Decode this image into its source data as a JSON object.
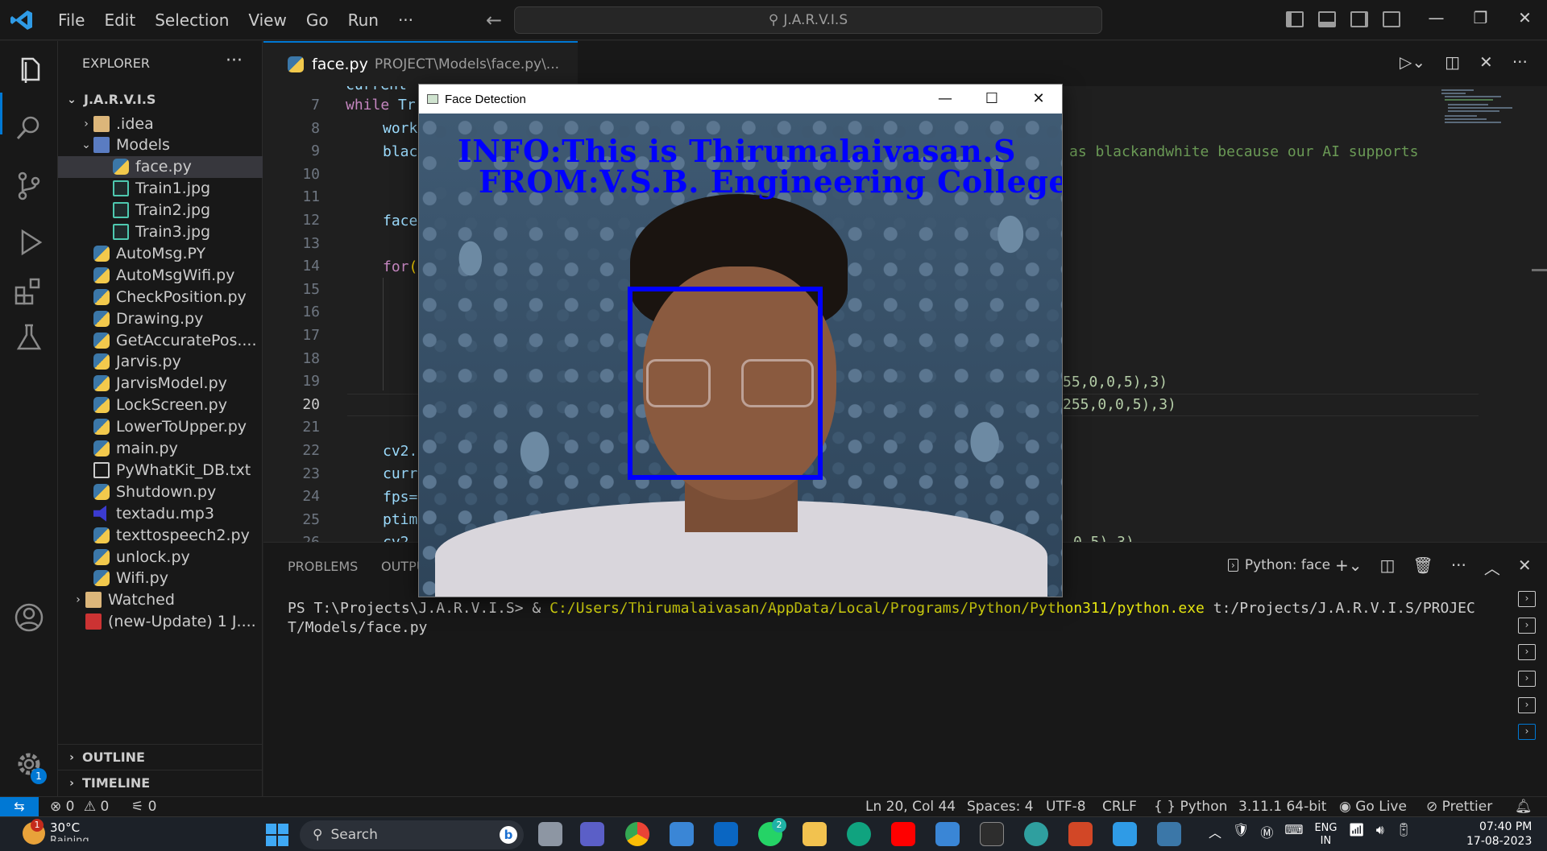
{
  "titlebar": {
    "menus": [
      "File",
      "Edit",
      "Selection",
      "View",
      "Go",
      "Run",
      "···"
    ],
    "command_center": "J.A.R.V.I.S"
  },
  "sidebar": {
    "header": "EXPLORER",
    "root": "J.A.R.V.I.S",
    "items": [
      {
        "label": ".idea",
        "depth": 1,
        "kind": "folder",
        "twisty": "›"
      },
      {
        "label": "Models",
        "depth": 1,
        "kind": "folderblue",
        "twisty": "⌄"
      },
      {
        "label": "face.py",
        "depth": 2,
        "kind": "py",
        "selected": true
      },
      {
        "label": "Train1.jpg",
        "depth": 2,
        "kind": "img"
      },
      {
        "label": "Train2.jpg",
        "depth": 2,
        "kind": "img"
      },
      {
        "label": "Train3.jpg",
        "depth": 2,
        "kind": "img"
      },
      {
        "label": "AutoMsg.PY",
        "depth": 1,
        "kind": "py"
      },
      {
        "label": "AutoMsgWifi.py",
        "depth": 1,
        "kind": "py"
      },
      {
        "label": "CheckPosition.py",
        "depth": 1,
        "kind": "py"
      },
      {
        "label": "Drawing.py",
        "depth": 1,
        "kind": "py"
      },
      {
        "label": "GetAccuratePos....",
        "depth": 1,
        "kind": "py"
      },
      {
        "label": "Jarvis.py",
        "depth": 1,
        "kind": "py"
      },
      {
        "label": "JarvisModel.py",
        "depth": 1,
        "kind": "py"
      },
      {
        "label": "LockScreen.py",
        "depth": 1,
        "kind": "py"
      },
      {
        "label": "LowerToUpper.py",
        "depth": 1,
        "kind": "py"
      },
      {
        "label": "main.py",
        "depth": 1,
        "kind": "py"
      },
      {
        "label": "PyWhatKit_DB.txt",
        "depth": 1,
        "kind": "txt"
      },
      {
        "label": "Shutdown.py",
        "depth": 1,
        "kind": "py"
      },
      {
        "label": "textadu.mp3",
        "depth": 1,
        "kind": "mp3"
      },
      {
        "label": "texttospeech2.py",
        "depth": 1,
        "kind": "py"
      },
      {
        "label": "unlock.py",
        "depth": 1,
        "kind": "py"
      },
      {
        "label": "Wifi.py",
        "depth": 1,
        "kind": "py"
      },
      {
        "label": "Watched",
        "depth": 0,
        "kind": "folder",
        "twisty": "›"
      },
      {
        "label": "(new-Update) 1 J....",
        "depth": 0,
        "kind": "vid"
      }
    ],
    "outline": "OUTLINE",
    "timeline": "TIMELINE"
  },
  "editor": {
    "tab_name": "face.py",
    "tab_path": "PROJECT\\Models\\face.py\\...",
    "line_numbers": [
      "7",
      "8",
      "9",
      "10",
      "11",
      "12",
      "13",
      "14",
      "15",
      "16",
      "17",
      "18",
      "19",
      "20",
      "21",
      "22",
      "23",
      "24",
      "25",
      "26"
    ],
    "current_line": "20",
    "code_fragments": {
      "l6": "current",
      "l7_kw": "while",
      "l7_rest": " Tr",
      "l8": "work",
      "l9": "blac",
      "l9_comment": "as blackandwhite because our AI supports",
      "l12": "face",
      "l14_kw": "for",
      "l14_br": "(",
      "l19_tail": "55,0,0,5),3)",
      "l20_tail": "255,0,0,5),3)",
      "l22": "cv2.",
      "l23": "curr",
      "l24": "fps=",
      "l25": "ptim",
      "l26": "cv2.",
      "l26_tail": "0,5),3)"
    }
  },
  "face_window": {
    "title": "Face Detection",
    "overlay_line1": "INFO:This is Thirumalaivasan.S",
    "overlay_line2": "FROM:V.S.B. Engineering College",
    "box_color": "#0000ff"
  },
  "panel": {
    "tabs": [
      "PROBLEMS",
      "OUTPU"
    ],
    "terminal_name": "Python: face",
    "prompt": "PS T:\\Projects\\J.A.R.V.I.S> & ",
    "exe": "C:/Users/Thirumalaivasan/AppData/Local/Programs/Python/Python311/python.exe",
    "args": " t:/Projects/J.A.R.V.I.S/PROJECT/Models/face.py"
  },
  "statusbar": {
    "errors": "0",
    "warnings": "0",
    "ports": "0",
    "position": "Ln 20, Col 44",
    "spaces": "Spaces: 4",
    "encoding": "UTF-8",
    "eol": "CRLF",
    "language": "Python",
    "interpreter": "3.11.1 64-bit",
    "golive": "Go Live",
    "prettier": "Prettier"
  },
  "taskbar": {
    "weather_temp": "30°C",
    "weather_badge": "1",
    "weather_desc": "Raining",
    "search": "Search",
    "whatsapp_badge": "2",
    "lang": "ENG",
    "lang2": "IN",
    "time": "07:40 PM",
    "date": "17-08-2023"
  },
  "accounts_badge": "1"
}
